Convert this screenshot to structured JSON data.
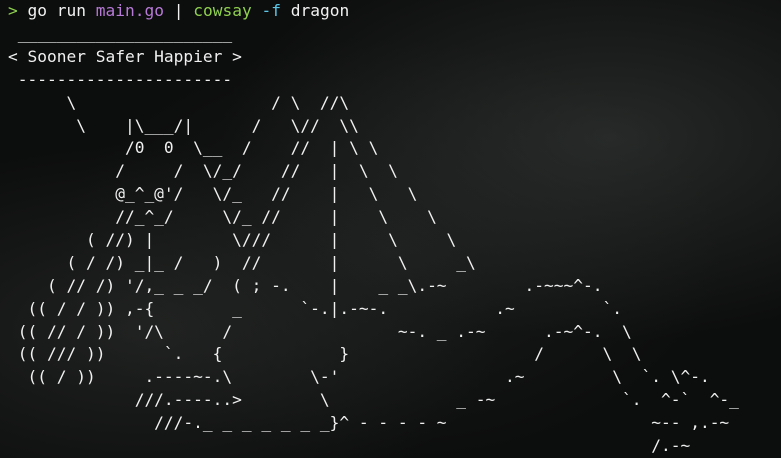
{
  "command": {
    "prompt_symbol": ">",
    "program": "go",
    "subcommand": "run",
    "file": "main.go",
    "pipe": "|",
    "program2": "cowsay",
    "flag": "-f",
    "flag_value": "dragon"
  },
  "output_lines": [
    " ______________________",
    "< Sooner Safer Happier >",
    " ----------------------",
    "      \\                    / \\  //\\",
    "       \\    |\\___/|      /   \\//  \\\\",
    "            /0  0  \\__  /    //  | \\ \\",
    "           /     /  \\/_/    //   |  \\  \\",
    "           @_^_@'/   \\/_   //    |   \\   \\",
    "           //_^_/     \\/_ //     |    \\    \\",
    "        ( //) |        \\///      |     \\     \\",
    "      ( / /) _|_ /   )  //       |      \\     _\\",
    "    ( // /) '/,_ _ _/  ( ; -.    |    _ _\\.-~        .-~~~^-.",
    "  (( / / )) ,-{        _      `-.|.-~-.           .~         `.",
    " (( // / ))  '/\\      /                 ~-. _ .-~      .-~^-.  \\",
    " (( /// ))      `.   {            }                   /      \\  \\",
    "  (( / ))     .----~-.\\        \\-'                 .~         \\  `. \\^-.",
    "             ///.----..>        \\             _ -~             `.  ^-`  ^-_",
    "               ///-._ _ _ _ _ _ _}^ - - - - ~                     ~-- ,.-~",
    "                                                                  /.-~"
  ]
}
